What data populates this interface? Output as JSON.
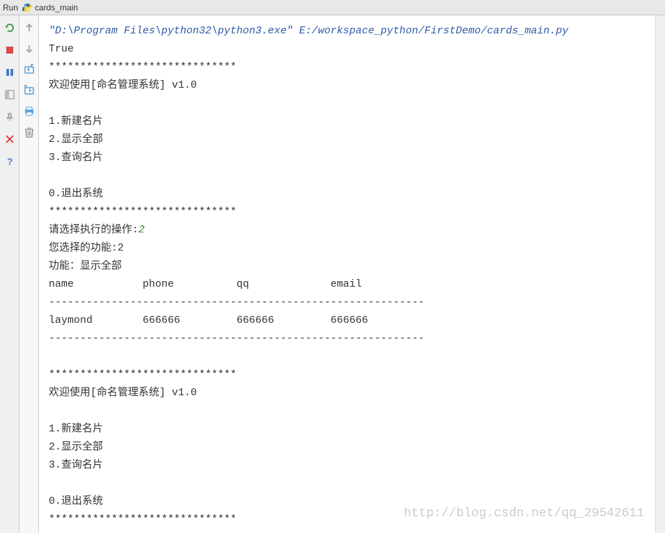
{
  "titlebar": {
    "run_label": "Run",
    "script_name": "cards_main"
  },
  "toolbar_left": {
    "rerun": "rerun",
    "stop": "stop",
    "pause": "pause",
    "layout": "layout",
    "pin": "pin",
    "close": "close",
    "help": "help"
  },
  "toolbar_right": {
    "step_up": "up",
    "step_down": "down",
    "restore": "restore",
    "export": "export",
    "print": "print",
    "delete": "delete"
  },
  "console": {
    "cmd_path": "\"D:\\Program Files\\python32\\python3.exe\" E:/workspace_python/FirstDemo/cards_main.py",
    "line_true": "True",
    "stars": "******************************",
    "welcome": "欢迎使用[命名管理系统] v1.0",
    "blank": "",
    "option1": "1.新建名片",
    "option2": "2.显示全部",
    "option3": "3.查询名片",
    "option0": "0.退出系统",
    "prompt": "请选择执行的操作:",
    "user_input": "2",
    "selected": "您选择的功能:2",
    "func_label": "功能：显示全部",
    "table_header": "name           phone          qq             email",
    "table_divider": "------------------------------------------------------------",
    "table_row1": "laymond        666666         666666         666666"
  },
  "watermark": "http://blog.csdn.net/qq_29542611"
}
